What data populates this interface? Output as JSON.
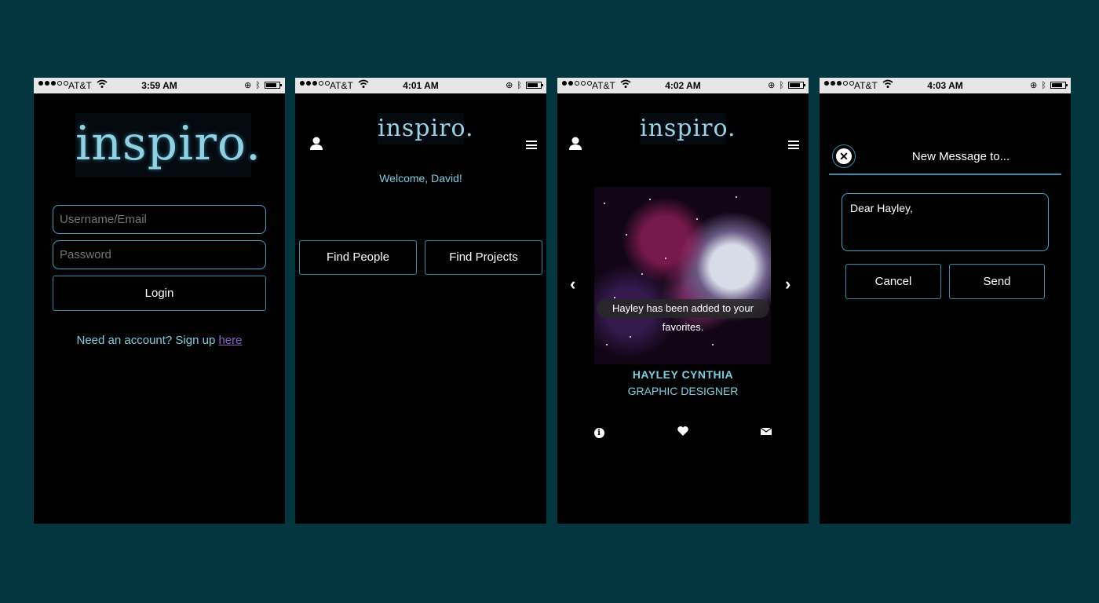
{
  "screens": [
    {
      "status": {
        "carrier": "AT&T",
        "time": "3:59 AM"
      },
      "logo": "inspiro.",
      "username_placeholder": "Username/Email",
      "password_placeholder": "Password",
      "login_label": "Login",
      "signup_text": "Need an account? Sign up ",
      "signup_link": "here"
    },
    {
      "status": {
        "carrier": "AT&T",
        "time": "4:01 AM"
      },
      "logo": "inspiro.",
      "welcome": "Welcome, David!",
      "find_people": "Find People",
      "find_projects": "Find Projects"
    },
    {
      "status": {
        "carrier": "AT&T",
        "time": "4:02 AM"
      },
      "logo": "inspiro.",
      "toast": "Hayley has been added to your favorites.",
      "profile_name": "HAYLEY CYNTHIA",
      "profile_role": "GRAPHIC DESIGNER",
      "prev_arrow": "‹",
      "next_arrow": "›"
    },
    {
      "status": {
        "carrier": "AT&T",
        "time": "4:03 AM"
      },
      "title": "New Message to...",
      "message": "Dear Hayley,",
      "cancel": "Cancel",
      "send": "Send"
    }
  ],
  "colors": {
    "background": "#043640",
    "accent": "#3aa8c6",
    "text_cyan": "#7ccfe2",
    "link": "#8e63c9"
  },
  "icons": [
    "signal-icon",
    "wifi-icon",
    "lock-rotation-icon",
    "bluetooth-icon",
    "battery-icon",
    "user-icon",
    "menu-icon",
    "info-icon",
    "heart-icon",
    "mail-icon",
    "close-icon"
  ]
}
